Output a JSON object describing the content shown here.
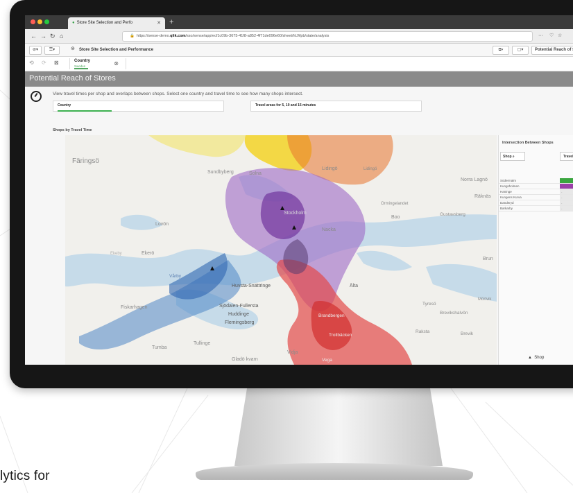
{
  "browser": {
    "tab_title": "Store Site Selection and Perfo",
    "url_prefix": "https://sense-demo.",
    "url_domain": "qlik.com",
    "url_path": "/sso/sense/app/ecf1c09b-3675-41f8-a852-4f71de096e60/sheet/hLWpb/state/analysis",
    "url_more": "···"
  },
  "toolbar": {
    "app_title": "Store Site Selection and Performance",
    "right_label": "Potential Reach of Store"
  },
  "selection": {
    "field": "Country",
    "value": "Sweden"
  },
  "sheet": {
    "title": "Potential Reach of Stores",
    "intro": "View travel times per shop and overlaps between shops. Select one country and travel time to see how many shops intersect.",
    "filter_country": "Country",
    "filter_travel": "Travel areas for 5, 10 and 15 minutes",
    "chart_title": "Shops by Travel Time"
  },
  "map_labels": [
    {
      "text": "Färingsö"
    },
    {
      "text": "Sundbyberg"
    },
    {
      "text": "Solna"
    },
    {
      "text": "Lidingö"
    },
    {
      "text": "Lidingö"
    },
    {
      "text": "Norra Lagnö"
    },
    {
      "text": "Räknäs"
    },
    {
      "text": "Ormingelandet"
    },
    {
      "text": "Gustavsberg"
    },
    {
      "text": "Boo"
    },
    {
      "text": "Nacka"
    },
    {
      "text": "Stockholm"
    },
    {
      "text": "Lovön"
    },
    {
      "text": "Ekerö"
    },
    {
      "text": "Ekeby"
    },
    {
      "text": "Vårby"
    },
    {
      "text": "Huvsta-Snättringe"
    },
    {
      "text": "Älta"
    },
    {
      "text": "Brun"
    },
    {
      "text": "Fiskarhagen"
    },
    {
      "text": "Sjödalen-Fullersta"
    },
    {
      "text": "Huddinge"
    },
    {
      "text": "Flemingsberg"
    },
    {
      "text": "Tullinge"
    },
    {
      "text": "Tumba"
    },
    {
      "text": "Gladö kvarn"
    },
    {
      "text": "Vidja"
    },
    {
      "text": "Tyresö"
    },
    {
      "text": "Brevikshalvön"
    },
    {
      "text": "Mörtvik"
    },
    {
      "text": "Rakstа"
    },
    {
      "text": "Brevik"
    },
    {
      "text": "Trollbäcken"
    },
    {
      "text": "Brandbergen"
    },
    {
      "text": "Vega"
    }
  ],
  "side_panel": {
    "title": "Intersection Between Shops",
    "shop_button": "Shop",
    "travel_header": "Travel are",
    "count": "1",
    "rows": [
      {
        "name": "Södermalm",
        "color": "#3aa63f"
      },
      {
        "name": "Kungsholmen",
        "color": "#9b3fa8"
      },
      {
        "name": "Haninge",
        "color": ""
      },
      {
        "name": "Kungens Kurva",
        "color": ""
      },
      {
        "name": "Danderyd",
        "color": ""
      },
      {
        "name": "Barkarby",
        "color": ""
      }
    ],
    "legend": "Shop"
  },
  "tagline": "lytics for"
}
